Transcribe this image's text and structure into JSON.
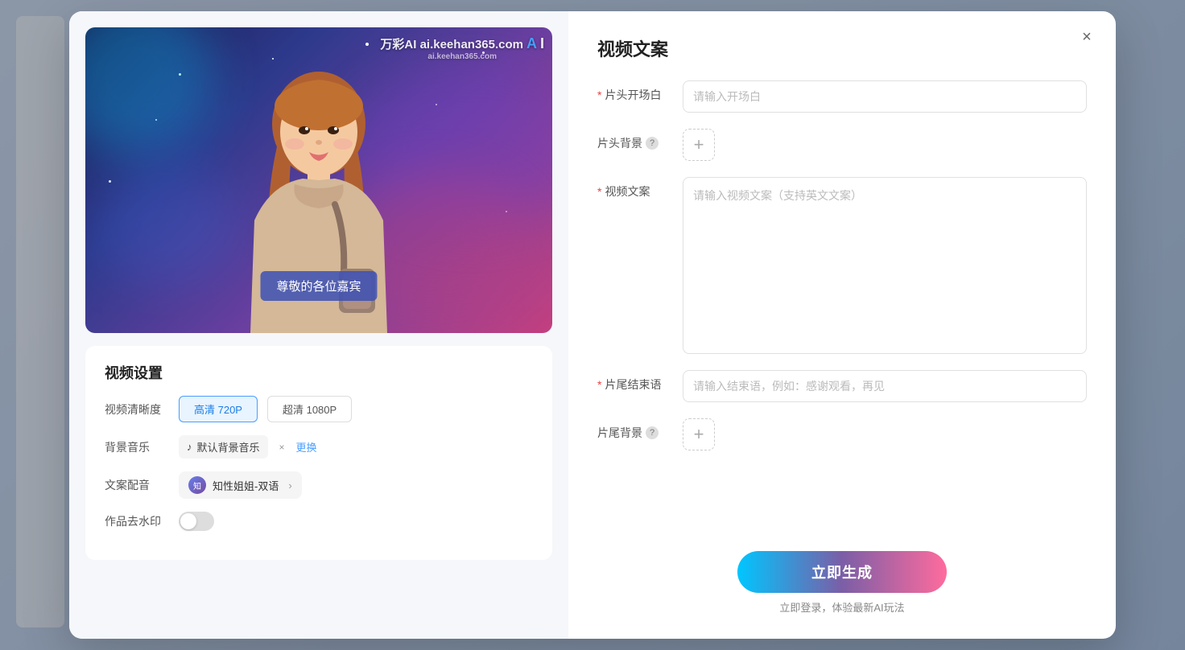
{
  "modal": {
    "close_label": "×",
    "left": {
      "preview": {
        "watermark": "万彩AI\nai.keehan365.com",
        "subtitle": "尊敬的各位嘉宾"
      },
      "settings": {
        "title": "视频设置",
        "quality_label": "视频清晰度",
        "quality_options": [
          {
            "label": "高清 720P",
            "active": true
          },
          {
            "label": "超清 1080P",
            "active": false
          }
        ],
        "music_label": "背景音乐",
        "music_icon": "♪",
        "music_name": "默认背景音乐",
        "music_close": "×",
        "music_change": "更换",
        "voice_label": "文案配音",
        "voice_name": "知性姐姐-双语",
        "watermark_label": "作品去水印",
        "toggle_on": false
      }
    },
    "right": {
      "title": "视频文案",
      "form": {
        "opening_label": "片头开场白",
        "opening_required": "*",
        "opening_placeholder": "请输入开场白",
        "bg_header_label": "片头背景",
        "bg_header_help": "?",
        "bg_add_label": "+",
        "script_label": "视频文案",
        "script_required": "*",
        "script_placeholder": "请输入视频文案（支持英文文案）",
        "ending_label": "片尾结束语",
        "ending_required": "*",
        "ending_placeholder": "请输入结束语，例如：感谢观看，再见",
        "bg_footer_label": "片尾背景",
        "bg_footer_help": "?",
        "bg_footer_add": "+"
      },
      "generate": {
        "btn_label": "立即生成",
        "hint": "立即登录，体验最新AI玩法"
      }
    }
  }
}
